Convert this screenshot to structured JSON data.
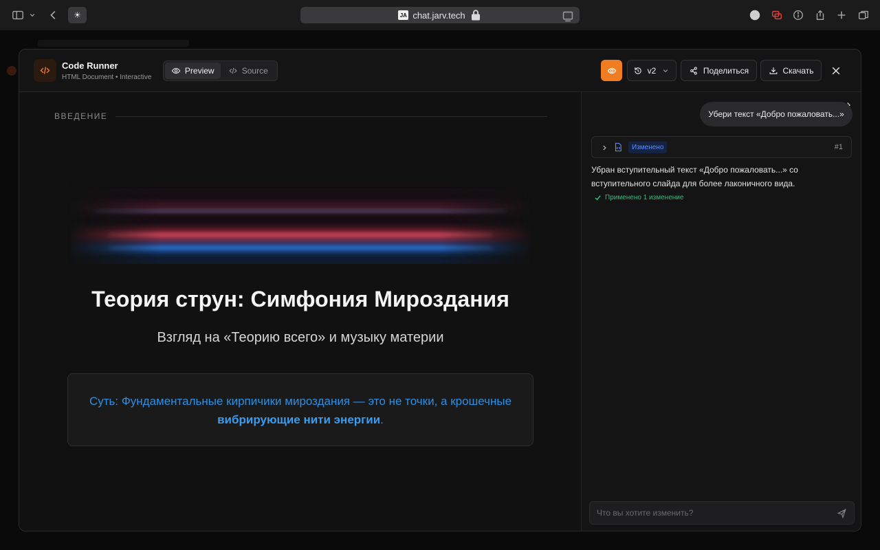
{
  "browser": {
    "url": "chat.jarv.tech",
    "site_badge": "JA",
    "favicon": "☀"
  },
  "app": {
    "name": "Code Runner",
    "subtitle": "HTML Document • Interactive",
    "accent_color": "#f07d22"
  },
  "view_toggle": {
    "preview_label": "Preview",
    "source_label": "Source",
    "active": "preview"
  },
  "toolbar": {
    "version_label": "v2",
    "share_label": "Поделиться",
    "download_label": "Скачать"
  },
  "slide": {
    "section_label": "ВВЕДЕНИЕ",
    "title": "Теория струн: Симфония Мироздания",
    "subtitle": "Взгляд на «Теорию всего» и музыку материи",
    "callout_text": "Суть: Фундаментальные кирпичики мироздания — это не точки, а крошечные ",
    "callout_bold": "вибрирующие нити энергии",
    "callout_end": "."
  },
  "chat": {
    "user_message": "Убери текст «Добро пожаловать...»",
    "change_badge": "Изменено",
    "change_number": "#1",
    "assistant_message": "Убран вступительный текст «Добро пожаловать...» со вступительного слайда для более лаконичного вида.",
    "applied_text": "Применено 1 изменение",
    "input_placeholder": "Что вы хотите изменить?"
  }
}
